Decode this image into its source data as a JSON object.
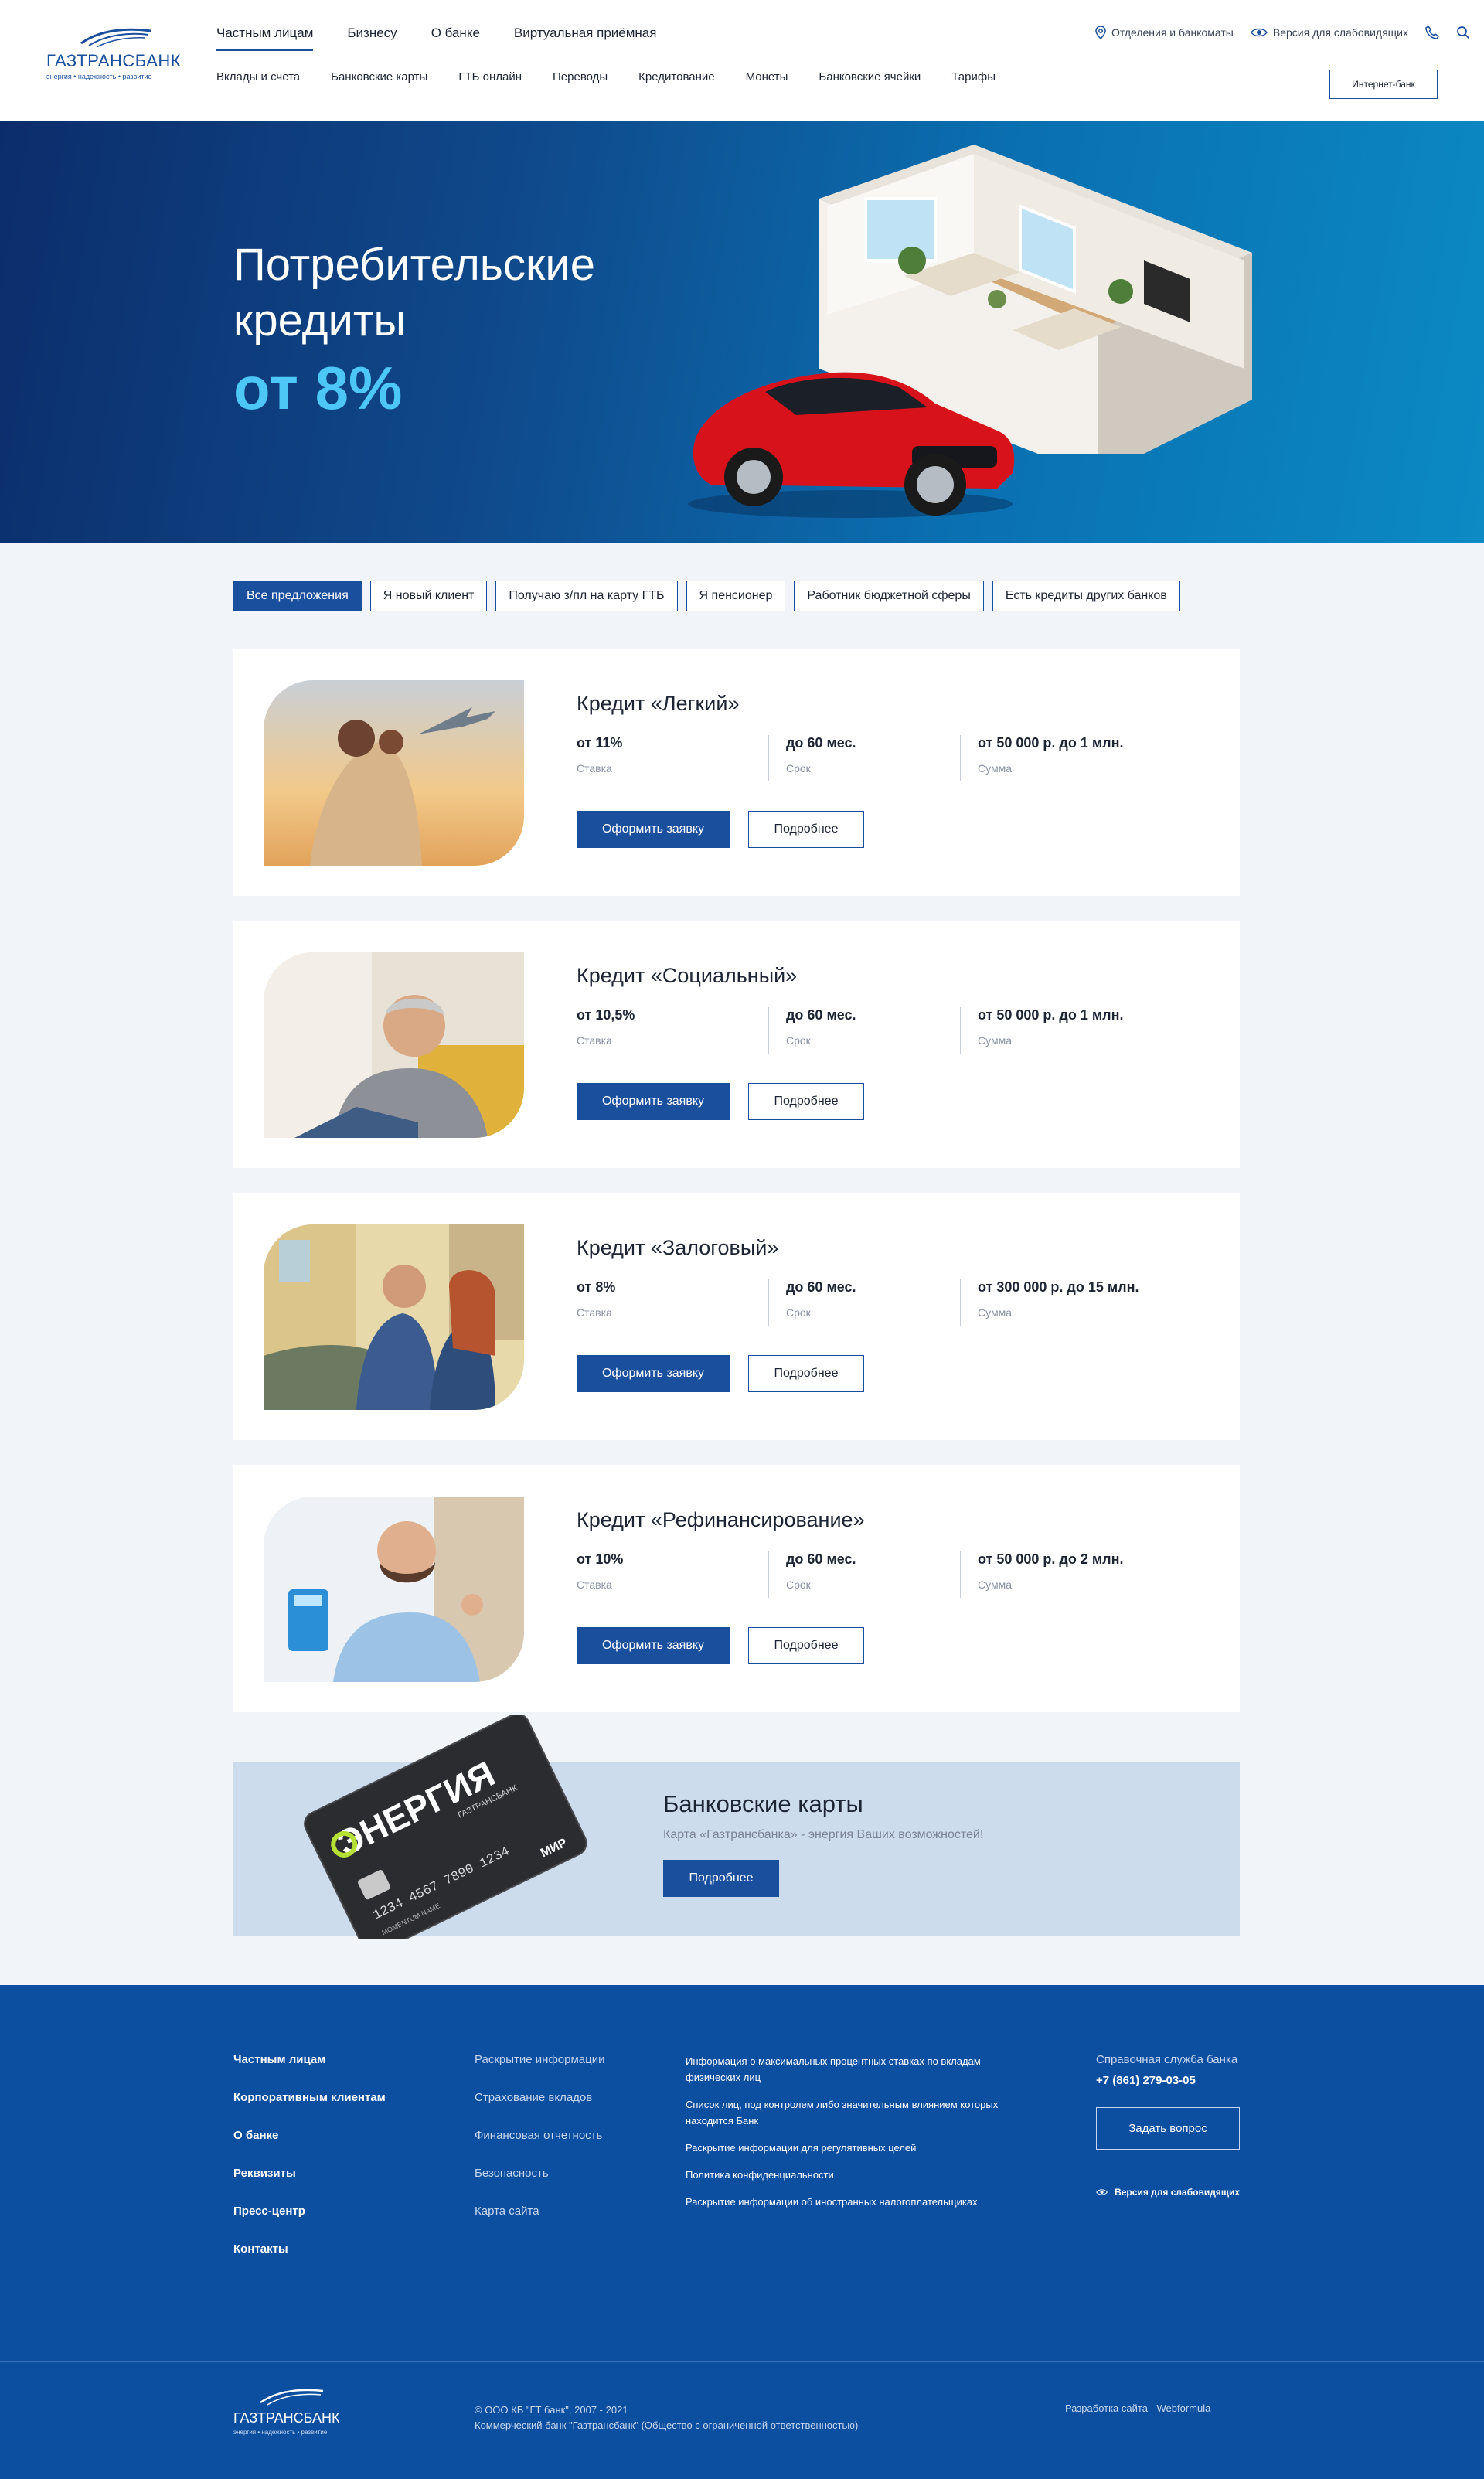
{
  "brand": {
    "name": "ГАЗТРАНСБАНК",
    "tagline": "энергия • надежность • развитие"
  },
  "colors": {
    "primary": "#1a4f9e",
    "hero_accent": "#4dc7f5",
    "footer_bg": "#0c4ea0"
  },
  "header": {
    "top_nav": [
      "Частным лицам",
      "Бизнесу",
      "О банке",
      "Виртуальная приёмная"
    ],
    "active_top_nav": "Частным лицам",
    "sub_nav": [
      "Вклады и счета",
      "Банковские карты",
      "ГТБ онлайн",
      "Переводы",
      "Кредитование",
      "Монеты",
      "Банковские ячейки",
      "Тарифы"
    ],
    "branches_label": "Отделения и банкоматы",
    "low_vision_label": "Версия для слабовидящих",
    "phone_icon": "phone-icon",
    "search_icon": "search-icon",
    "internet_bank_label": "Интернет-банк"
  },
  "hero": {
    "title": "Потребительские кредиты",
    "rate": "от 8%"
  },
  "filters": [
    "Все предложения",
    "Я новый клиент",
    "Получаю з/пл на карту ГТБ",
    "Я пенсионер",
    "Работник бюджетной сферы",
    "Есть кредиты других банков"
  ],
  "active_filter": "Все предложения",
  "credits": [
    {
      "title": "Кредит «Легкий»",
      "rate": "от 11%",
      "rate_label": "Ставка",
      "term": "до 60 мес.",
      "term_label": "Срок",
      "amount": "от 50 000 р. до 1 млн.",
      "amount_label": "Сумма",
      "apply_label": "Оформить заявку",
      "more_label": "Подробнее"
    },
    {
      "title": "Кредит «Социальный»",
      "rate": "от 10,5%",
      "rate_label": "Ставка",
      "term": "до 60 мес.",
      "term_label": "Срок",
      "amount": "от 50 000 р. до 1 млн.",
      "amount_label": "Сумма",
      "apply_label": "Оформить заявку",
      "more_label": "Подробнее"
    },
    {
      "title": "Кредит «Залоговый»",
      "rate": "от 8%",
      "rate_label": "Ставка",
      "term": "до 60 мес.",
      "term_label": "Срок",
      "amount": "от 300 000 р. до 15 млн.",
      "amount_label": "Сумма",
      "apply_label": "Оформить заявку",
      "more_label": "Подробнее"
    },
    {
      "title": "Кредит «Рефинансирование»",
      "rate": "от 10%",
      "rate_label": "Ставка",
      "term": "до 60 мес.",
      "term_label": "Срок",
      "amount": "от 50 000 р. до 2 млн.",
      "amount_label": "Сумма",
      "apply_label": "Оформить заявку",
      "more_label": "Подробнее"
    }
  ],
  "promo": {
    "title": "Банковские карты",
    "subtitle": "Карта «Газтрансбанка» - энергия Ваших возможностей!",
    "button": "Подробнее",
    "card_brand": "ЭНЕРГИЯ",
    "card_bank": "ГАЗТРАНСБАНК",
    "card_number": "1234 4567 7890 1234",
    "card_holder": "MOMENTUM NAME",
    "card_system": "МИР"
  },
  "footer": {
    "col1": [
      "Частным лицам",
      "Корпоративным клиентам",
      "О банке",
      "Реквизиты",
      "Пресс-центр",
      "Контакты"
    ],
    "col2": [
      "Раскрытие информации",
      "Страхование вкладов",
      "Финансовая отчетность",
      "Безопасность",
      "Карта сайта"
    ],
    "col3": [
      "Информация о максимальных процентных ставках по вкладам физических лиц",
      "Список лиц, под контролем либо значительным влиянием которых находится Банк",
      "Раскрытие информации для регулятивных целей",
      "Политика конфиденциальности",
      "Раскрытие информации об иностранных налогоплательщиках"
    ],
    "help_label": "Справочная служба банка",
    "help_phone": "+7 (861) 279-03-05",
    "ask_button": "Задать вопрос",
    "low_vision": "Версия для слабовидящих",
    "copyright_line1": "© ООО КБ \"ГТ банк\", 2007 - 2021",
    "copyright_line2": "Коммерческий банк \"Газтрансбанк\" (Общество с ограниченной ответственностью)",
    "developer": "Разработка сайта - Webformula"
  }
}
